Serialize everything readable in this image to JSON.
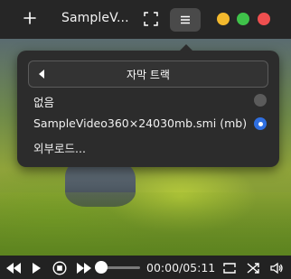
{
  "titlebar": {
    "title": "SampleV...",
    "icons": {
      "add": "plus-icon",
      "fullscreen": "fullscreen-icon",
      "menu": "menu-icon"
    },
    "window_controls": {
      "minimize_color": "#f3b92d",
      "maximize_color": "#3fc24a",
      "close_color": "#ef4f4f"
    }
  },
  "subtitle_menu": {
    "header": "자막 트랙",
    "options": [
      {
        "label": "없음",
        "selected": false
      },
      {
        "label": "SampleVideo360×24030mb.smi (mb)",
        "selected": true
      },
      {
        "label": "외부로드..."
      }
    ]
  },
  "playback": {
    "time": "00:00/05:11",
    "icons": {
      "rewind": "rewind-icon",
      "play": "play-icon",
      "stop": "stop-icon",
      "forward": "fast-forward-icon",
      "repeat": "repeat-icon",
      "shuffle": "shuffle-icon",
      "volume": "volume-icon"
    }
  }
}
